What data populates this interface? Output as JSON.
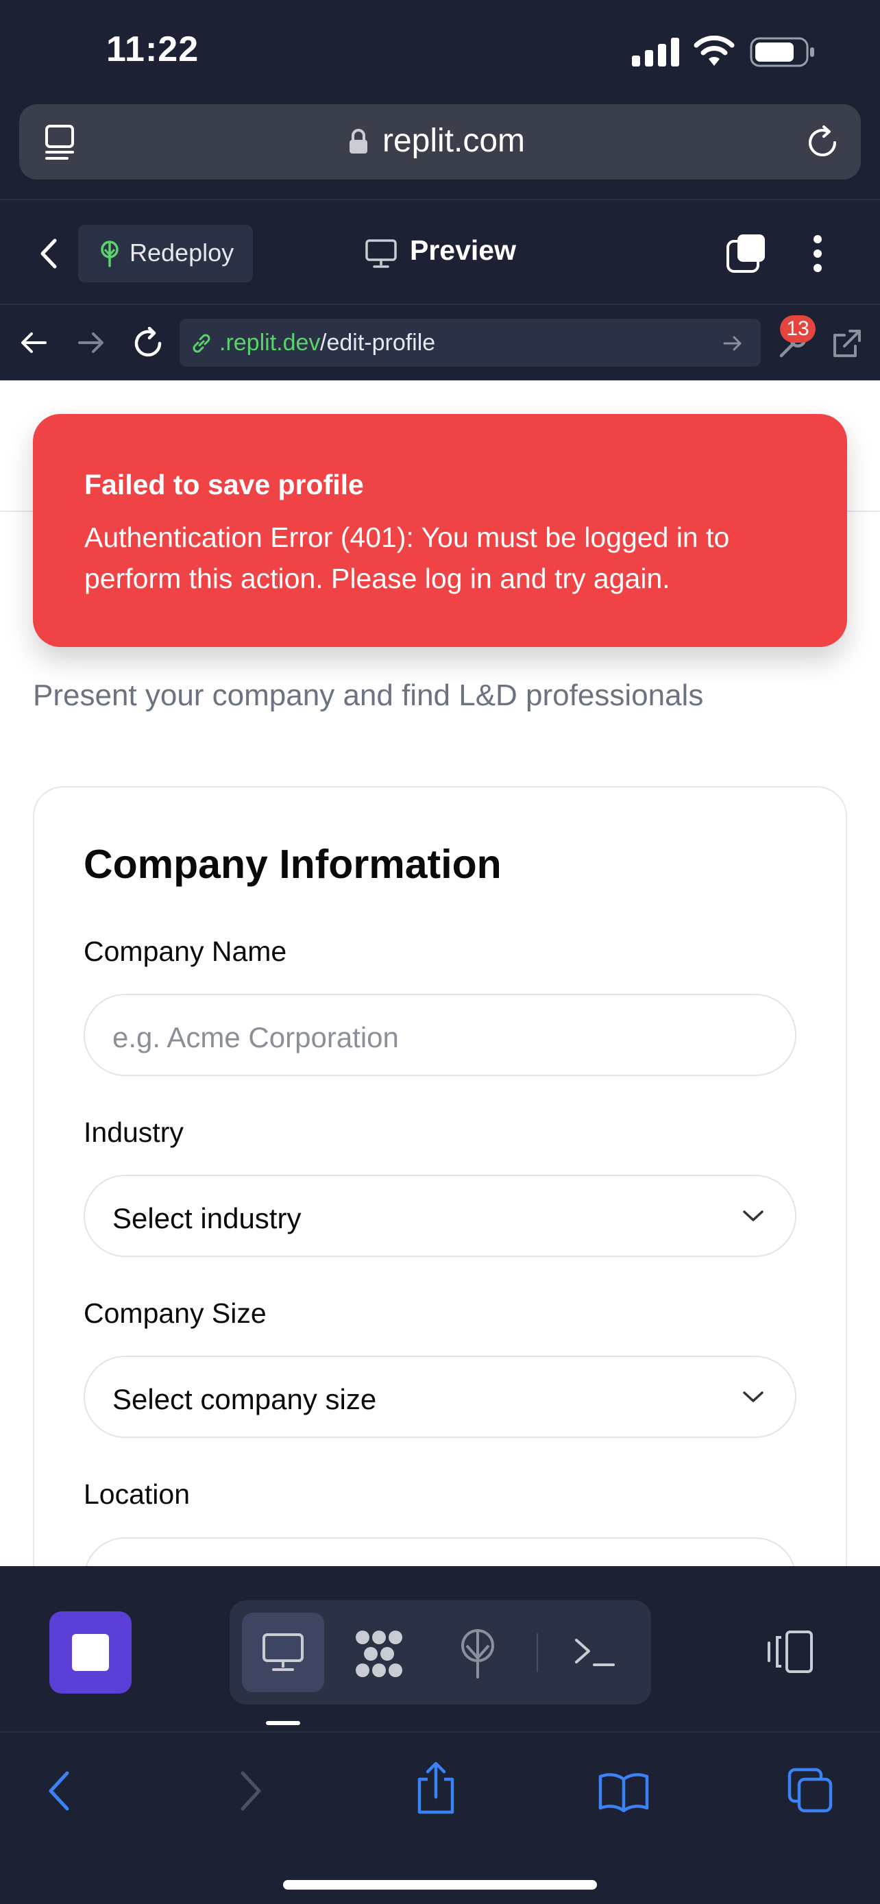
{
  "status_bar": {
    "time": "11:22"
  },
  "browser": {
    "url": "replit.com"
  },
  "replit_header": {
    "redeploy_label": "Redeploy",
    "preview_label": "Preview"
  },
  "webview": {
    "domain": ".replit.dev",
    "path": "/edit-profile",
    "devtools_badge": "13"
  },
  "page": {
    "subtitle": "Present your company and find L&D professionals",
    "card_title": "Company Information",
    "fields": {
      "company_name": {
        "label": "Company Name",
        "placeholder": "e.g. Acme Corporation"
      },
      "industry": {
        "label": "Industry",
        "value": "Select industry"
      },
      "company_size": {
        "label": "Company Size",
        "value": "Select company size"
      },
      "location": {
        "label": "Location"
      }
    }
  },
  "toast": {
    "title": "Failed to save profile",
    "message": "Authentication Error (401): You must be logged in to perform this action. Please log in and try again."
  },
  "colors": {
    "error": "#ef4346",
    "accent": "#5b3fd6",
    "link_green": "#5bd36d",
    "chrome_bg": "#1c2233"
  }
}
